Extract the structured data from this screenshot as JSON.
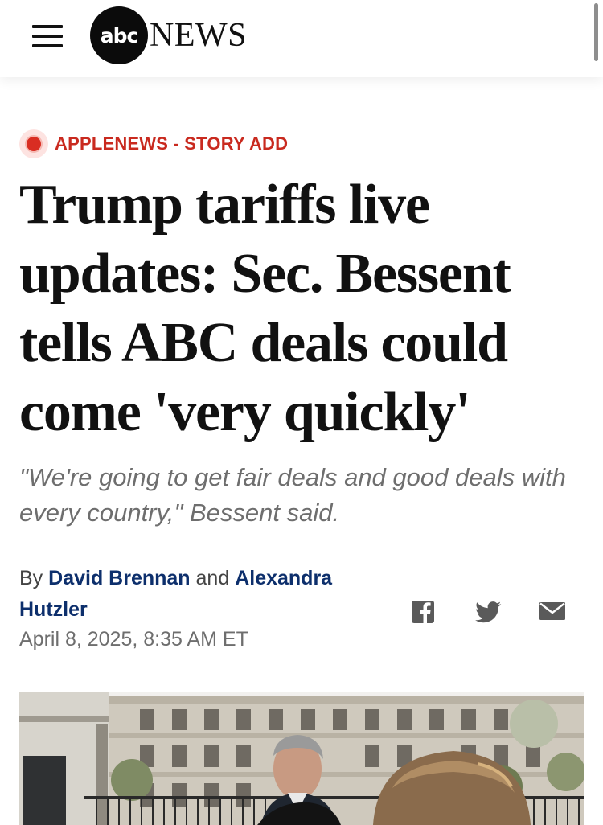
{
  "header": {
    "logo_disc": "abc",
    "logo_word": "NEWS"
  },
  "article": {
    "kicker": "APPLENEWS - STORY ADD",
    "headline": "Trump tariffs live updates: Sec. Bessent tells ABC deals could come 'very quickly'",
    "subheadline": "\"We're going to get fair deals and good deals with every country,\" Bessent said.",
    "byline": {
      "prefix": "By",
      "author1": "David Brennan",
      "conjunction": "and",
      "author2": "Alexandra Hutzler"
    },
    "timestamp": "April 8, 2025, 8:35 AM ET"
  },
  "share": {
    "icons": [
      "facebook-icon",
      "twitter-icon",
      "email-icon"
    ]
  },
  "colors": {
    "kicker": "#c92a1f",
    "author_link": "#0d2f6c",
    "subhead": "#6e6e6e"
  }
}
